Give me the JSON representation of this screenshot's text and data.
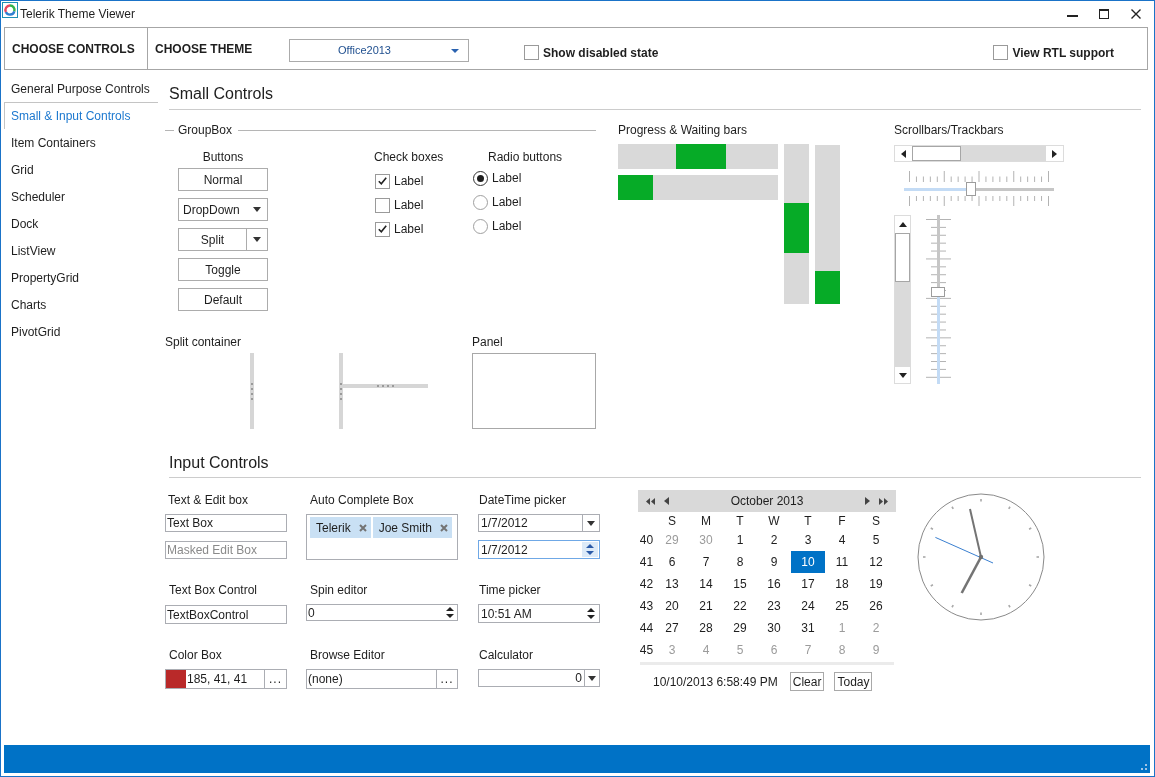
{
  "window": {
    "title": "Telerik Theme Viewer"
  },
  "toolbar": {
    "controls_label": "CHOOSE CONTROLS",
    "theme_label": "CHOOSE THEME",
    "theme_dropdown": {
      "value": "Office2013"
    },
    "options": [
      {
        "label": "Show disabled state",
        "checked": false
      },
      {
        "label": "View RTL support",
        "checked": false
      }
    ]
  },
  "sidebar": {
    "items": [
      {
        "label": "General Purpose Controls",
        "selected": false
      },
      {
        "label": "Small & Input Controls",
        "selected": true
      },
      {
        "label": "Item Containers",
        "selected": false
      },
      {
        "label": "Grid",
        "selected": false
      },
      {
        "label": "Scheduler",
        "selected": false
      },
      {
        "label": "Dock",
        "selected": false
      },
      {
        "label": "ListView",
        "selected": false
      },
      {
        "label": "PropertyGrid",
        "selected": false
      },
      {
        "label": "Charts",
        "selected": false
      },
      {
        "label": "PivotGrid",
        "selected": false
      }
    ]
  },
  "small_controls": {
    "title": "Small Controls",
    "group_box": {
      "legend": "GroupBox",
      "buttons": {
        "title": "Buttons",
        "items": [
          {
            "label": "Normal",
            "kind": "push"
          },
          {
            "label": "DropDown",
            "kind": "dropdown"
          },
          {
            "label": "Split",
            "kind": "split"
          },
          {
            "label": "Toggle",
            "kind": "push"
          },
          {
            "label": "Default",
            "kind": "push"
          }
        ]
      },
      "check_boxes": {
        "title": "Check boxes",
        "items": [
          {
            "label": "Label",
            "checked": true
          },
          {
            "label": "Label",
            "checked": false
          },
          {
            "label": "Label",
            "checked": true
          }
        ]
      },
      "radio_buttons": {
        "title": "Radio buttons",
        "items": [
          {
            "label": "Label",
            "selected": true
          },
          {
            "label": "Label",
            "selected": false
          },
          {
            "label": "Label",
            "selected": false
          }
        ]
      }
    },
    "split_container": {
      "title": "Split container"
    },
    "panel": {
      "title": "Panel"
    },
    "progress_bars": {
      "title": "Progress & Waiting bars",
      "horizontal": [
        {
          "kind": "waiting"
        },
        {
          "kind": "progress",
          "level": 0.22
        }
      ],
      "vertical": [
        {
          "kind": "waiting"
        },
        {
          "kind": "progress",
          "level": 0.21
        }
      ]
    },
    "scrollbars": {
      "title": "Scrollbars/Trackbars",
      "horizontal_trackbar": {
        "level": 0.44
      },
      "vertical_trackbar": {
        "level": 0.54
      }
    }
  },
  "input_controls": {
    "title": "Input Controls",
    "text_edit": {
      "title": "Text & Edit box",
      "text_box": {
        "value": "Text Box"
      },
      "masked_edit_box": {
        "placeholder": "Masked Edit Box"
      }
    },
    "auto_complete": {
      "title": "Auto Complete Box",
      "tokens": [
        "Telerik",
        "Joe Smith"
      ]
    },
    "datetime_picker": {
      "title": "DateTime picker",
      "pickers": [
        {
          "value": "1/7/2012",
          "kind": "dropdown",
          "focused": false
        },
        {
          "value": "1/7/2012",
          "kind": "spin",
          "focused": true
        }
      ]
    },
    "text_box_control": {
      "title": "Text Box Control",
      "value": "TextBoxControl"
    },
    "spin_editor": {
      "title": "Spin editor",
      "value": "0"
    },
    "time_picker": {
      "title": "Time picker",
      "value": "10:51 AM"
    },
    "color_box": {
      "title": "Color Box",
      "value": "185, 41, 41",
      "color": "#b92929",
      "button": "..."
    },
    "browse_editor": {
      "title": "Browse Editor",
      "value": "(none)",
      "button": "..."
    },
    "calculator": {
      "title": "Calculator",
      "value": "0"
    },
    "calendar": {
      "title": "October 2013",
      "weekdays": [
        "S",
        "M",
        "T",
        "W",
        "T",
        "F",
        "S"
      ],
      "weeks": [
        {
          "number": "40",
          "days": [
            {
              "label": "29",
              "other_month": true,
              "selected": false
            },
            {
              "label": "30",
              "other_month": true,
              "selected": false
            },
            {
              "label": "1",
              "other_month": false,
              "selected": false
            },
            {
              "label": "2",
              "other_month": false,
              "selected": false
            },
            {
              "label": "3",
              "other_month": false,
              "selected": false
            },
            {
              "label": "4",
              "other_month": false,
              "selected": false
            },
            {
              "label": "5",
              "other_month": false,
              "selected": false
            }
          ]
        },
        {
          "number": "41",
          "days": [
            {
              "label": "6",
              "other_month": false,
              "selected": false
            },
            {
              "label": "7",
              "other_month": false,
              "selected": false
            },
            {
              "label": "8",
              "other_month": false,
              "selected": false
            },
            {
              "label": "9",
              "other_month": false,
              "selected": false
            },
            {
              "label": "10",
              "other_month": false,
              "selected": true
            },
            {
              "label": "11",
              "other_month": false,
              "selected": false
            },
            {
              "label": "12",
              "other_month": false,
              "selected": false
            }
          ]
        },
        {
          "number": "42",
          "days": [
            {
              "label": "13",
              "other_month": false,
              "selected": false
            },
            {
              "label": "14",
              "other_month": false,
              "selected": false
            },
            {
              "label": "15",
              "other_month": false,
              "selected": false
            },
            {
              "label": "16",
              "other_month": false,
              "selected": false
            },
            {
              "label": "17",
              "other_month": false,
              "selected": false
            },
            {
              "label": "18",
              "other_month": false,
              "selected": false
            },
            {
              "label": "19",
              "other_month": false,
              "selected": false
            }
          ]
        },
        {
          "number": "43",
          "days": [
            {
              "label": "20",
              "other_month": false,
              "selected": false
            },
            {
              "label": "21",
              "other_month": false,
              "selected": false
            },
            {
              "label": "22",
              "other_month": false,
              "selected": false
            },
            {
              "label": "23",
              "other_month": false,
              "selected": false
            },
            {
              "label": "24",
              "other_month": false,
              "selected": false
            },
            {
              "label": "25",
              "other_month": false,
              "selected": false
            },
            {
              "label": "26",
              "other_month": false,
              "selected": false
            }
          ]
        },
        {
          "number": "44",
          "days": [
            {
              "label": "27",
              "other_month": false,
              "selected": false
            },
            {
              "label": "28",
              "other_month": false,
              "selected": false
            },
            {
              "label": "29",
              "other_month": false,
              "selected": false
            },
            {
              "label": "30",
              "other_month": false,
              "selected": false
            },
            {
              "label": "31",
              "other_month": false,
              "selected": false
            },
            {
              "label": "1",
              "other_month": true,
              "selected": false
            },
            {
              "label": "2",
              "other_month": true,
              "selected": false
            }
          ]
        },
        {
          "number": "45",
          "days": [
            {
              "label": "3",
              "other_month": true,
              "selected": false
            },
            {
              "label": "4",
              "other_month": true,
              "selected": false
            },
            {
              "label": "5",
              "other_month": true,
              "selected": false
            },
            {
              "label": "6",
              "other_month": true,
              "selected": false
            },
            {
              "label": "7",
              "other_month": true,
              "selected": false
            },
            {
              "label": "8",
              "other_month": true,
              "selected": false
            },
            {
              "label": "9",
              "other_month": true,
              "selected": false
            }
          ]
        }
      ],
      "footer": {
        "datetime": "10/10/2013 6:58:49 PM",
        "buttons": [
          "Clear",
          "Today"
        ]
      }
    }
  }
}
